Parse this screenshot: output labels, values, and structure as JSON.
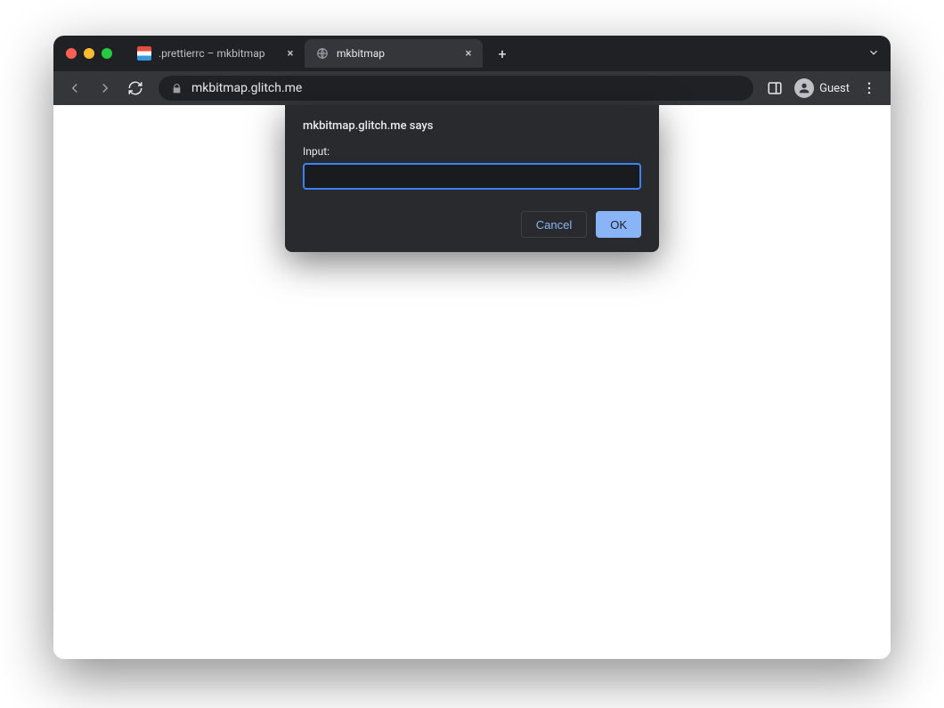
{
  "browser": {
    "tabs": [
      {
        "title": ".prettierrc – mkbitmap",
        "active": false,
        "favicon": "glitch"
      },
      {
        "title": "mkbitmap",
        "active": true,
        "favicon": "globe"
      }
    ],
    "address": "mkbitmap.glitch.me",
    "profile_label": "Guest"
  },
  "dialog": {
    "origin_says": "mkbitmap.glitch.me says",
    "prompt_label": "Input:",
    "input_value": "",
    "cancel_label": "Cancel",
    "ok_label": "OK"
  }
}
